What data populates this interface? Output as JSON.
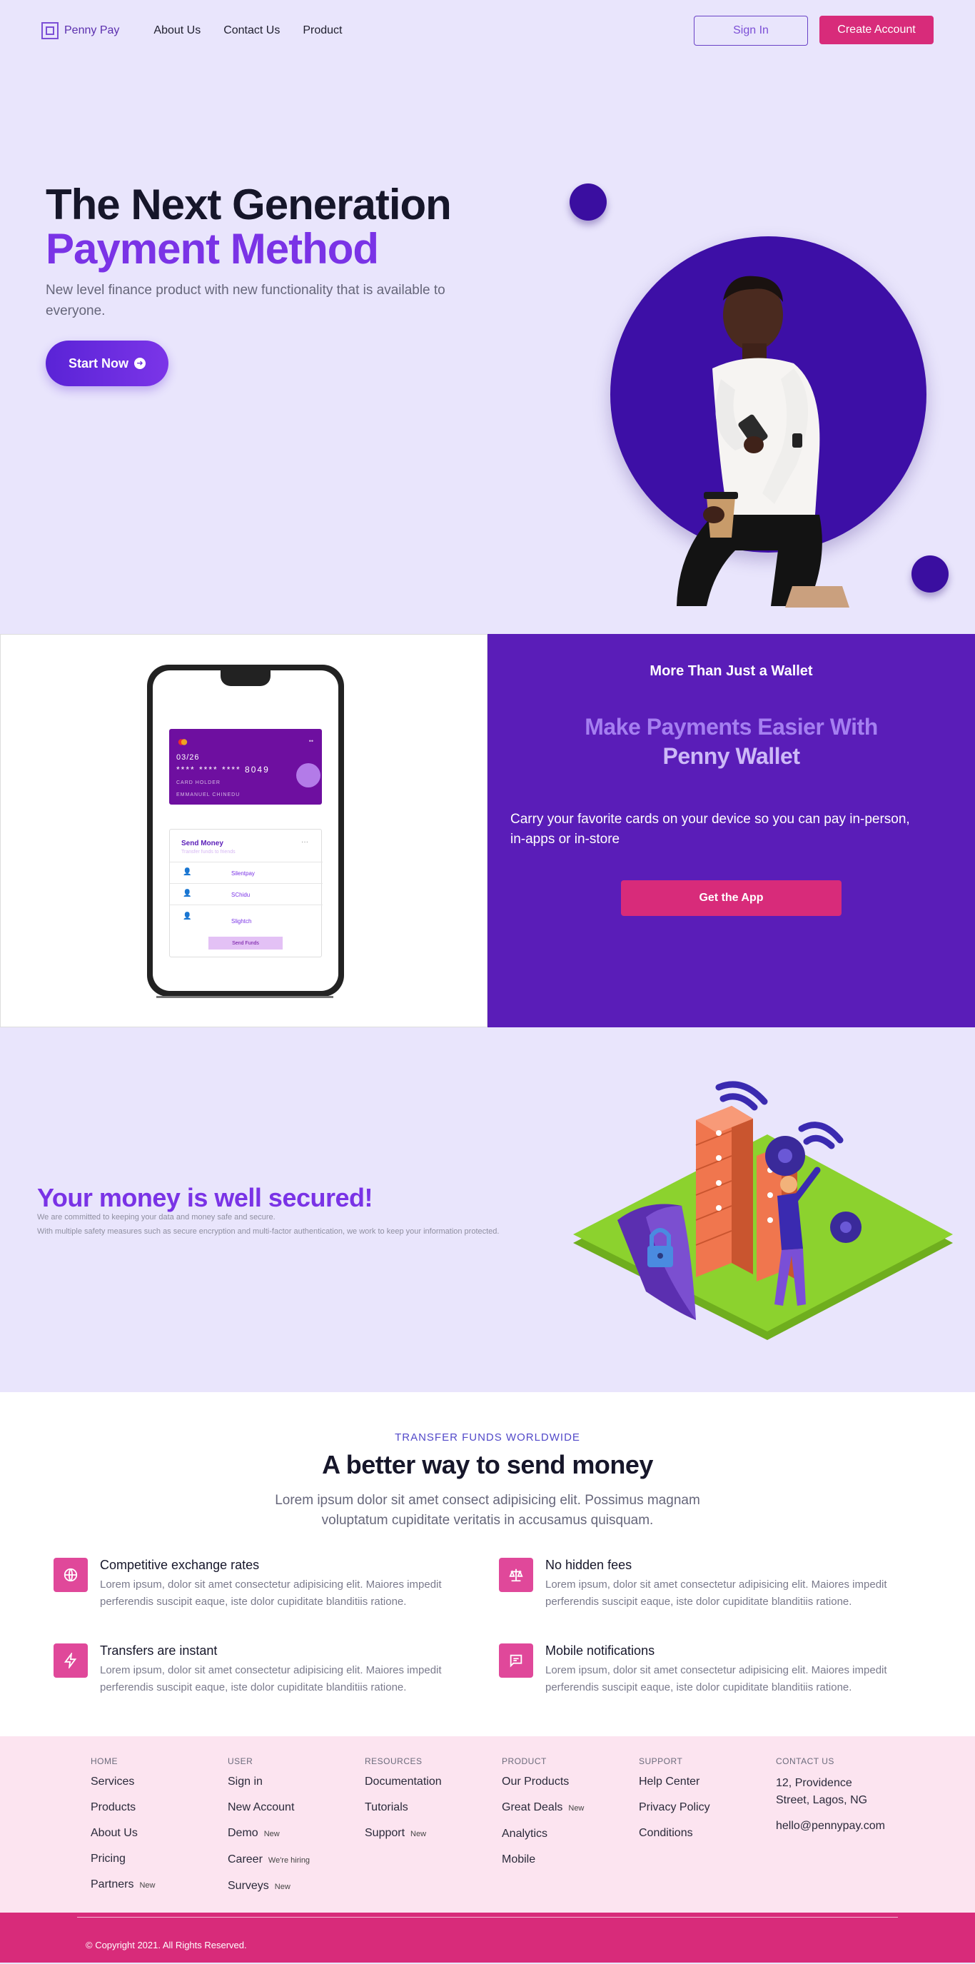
{
  "nav": {
    "brand": "Penny Pay",
    "links": [
      "About Us",
      "Contact Us",
      "Product"
    ],
    "sign_in": "Sign In",
    "create_account": "Create Account"
  },
  "hero": {
    "title_line1": "The Next Generation",
    "title_line2": "Payment Method",
    "subtitle": "New level finance product with new functionality that is available to everyone.",
    "cta": "Start Now"
  },
  "wallet": {
    "eyebrow": "More Than Just a Wallet",
    "title_line1": "Make Payments Easier With",
    "title_line2": "Penny Wallet",
    "text": "Carry your favorite cards on your device so you can pay in-person, in-apps or in-store",
    "cta": "Get the App",
    "phone": {
      "card_dots": "••",
      "card_date": "03/26",
      "card_number": "****  ****  ****  8049",
      "card_holder": "CARD HOLDER",
      "card_name": "EMMANUEL CHINEDU",
      "send_title": "Send Money",
      "send_sub": "Transfer funds to friends",
      "more": "···",
      "contacts": [
        "Silentpay",
        "SChidu",
        "Slightch"
      ],
      "send_button": "Send Funds"
    }
  },
  "security": {
    "title": "Your money is well secured!",
    "line1": "We are committed to keeping your data and money safe and secure.",
    "line2": "With multiple safety measures such as secure encryption and multi-factor authentication, we work to keep your information protected."
  },
  "send_money": {
    "eyebrow": "TRANSFER FUNDS WORLDWIDE",
    "title": "A better way to send money",
    "subtitle": "Lorem ipsum dolor sit amet consect adipisicing elit. Possimus magnam voluptatum cupiditate veritatis in accusamus quisquam.",
    "features": [
      {
        "icon": "globe-icon",
        "title": "Competitive exchange rates",
        "text": "Lorem ipsum, dolor sit amet consectetur adipisicing elit. Maiores impedit perferendis suscipit eaque, iste dolor cupiditate blanditiis ratione."
      },
      {
        "icon": "scale-icon",
        "title": "No hidden fees",
        "text": "Lorem ipsum, dolor sit amet consectetur adipisicing elit. Maiores impedit perferendis suscipit eaque, iste dolor cupiditate blanditiis ratione."
      },
      {
        "icon": "lightning-icon",
        "title": "Transfers are instant",
        "text": "Lorem ipsum, dolor sit amet consectetur adipisicing elit. Maiores impedit perferendis suscipit eaque, iste dolor cupiditate blanditiis ratione."
      },
      {
        "icon": "chat-icon",
        "title": "Mobile notifications",
        "text": "Lorem ipsum, dolor sit amet consectetur adipisicing elit. Maiores impedit perferendis suscipit eaque, iste dolor cupiditate blanditiis ratione."
      }
    ]
  },
  "footer": {
    "home": {
      "head": "HOME",
      "items": [
        "Services",
        "Products",
        "About Us",
        "Pricing",
        "Partners"
      ],
      "partners_tag": "New"
    },
    "user": {
      "head": "USER",
      "items": [
        "Sign in",
        "New Account",
        "Demo",
        "Career",
        "Surveys"
      ],
      "demo_tag": "New",
      "career_tag": "We're hiring",
      "surveys_tag": "New"
    },
    "resources": {
      "head": "RESOURCES",
      "items": [
        "Documentation",
        "Tutorials",
        "Support"
      ],
      "support_tag": "New"
    },
    "product": {
      "head": "PRODUCT",
      "items": [
        "Our Products",
        "Great Deals",
        "Analytics",
        "Mobile"
      ],
      "deals_tag": "New"
    },
    "support": {
      "head": "SUPPORT",
      "items": [
        "Help Center",
        "Privacy Policy",
        "Conditions"
      ]
    },
    "contact": {
      "head": "CONTACT US",
      "address_line1": "12, Providence",
      "address_line2": "Street, Lagos, NG",
      "email": "hello@pennypay.com"
    },
    "copyright": "© Copyright 2021. All Rights Reserved."
  },
  "colors": {
    "brand_purple": "#7a33e6",
    "deep_purple": "#5a1db8",
    "pink": "#d82b7a",
    "lavender_bg": "#e9e5fc"
  }
}
